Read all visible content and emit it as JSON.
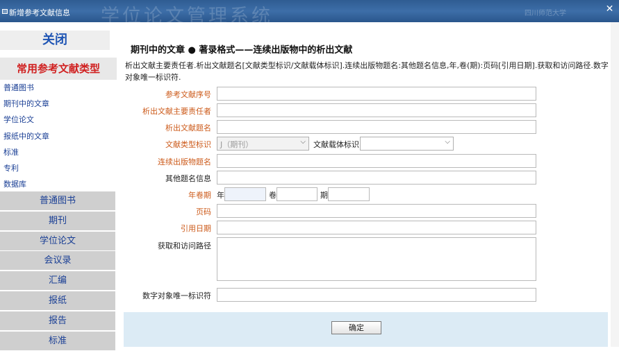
{
  "window": {
    "title": "新增参考文献信息",
    "background_text": "学位论文管理系统",
    "school_text": "四川师范大学",
    "close_icon": "close-icon"
  },
  "sidebar": {
    "close_label": "关闭",
    "category_title": "常用参考文献类型",
    "links": [
      "普通图书",
      "期刊中的文章",
      "学位论文",
      "报纸中的文章",
      "标准",
      "专利",
      "数据库"
    ],
    "buttons": [
      "普通图书",
      "期刊",
      "学位论文",
      "会议录",
      "汇编",
      "报纸",
      "报告",
      "标准"
    ]
  },
  "main": {
    "heading": "期刊中的文章 ● 著录格式——连续出版物中的析出文献",
    "description": "析出文献主要责任者.析出文献题名[文献类型标识/文献载体标识].连续出版物题名:其他题名信息,年,卷(期):页码[引用日期].获取和访问路径.数字对象唯一标识符.",
    "fields": {
      "seq": "参考文献序号",
      "author": "析出文献主要责任者",
      "title": "析出文献题名",
      "doc_type": "文献类型标识",
      "doc_type_value": "J（期刊）",
      "carrier": "文献载体标识",
      "carrier_value": "",
      "serial_title": "连续出版物题名",
      "other_title": "其他题名信息",
      "year_vol": "年卷期",
      "year": "年",
      "volume": "卷",
      "issue": "期",
      "pages": "页码",
      "cite_date": "引用日期",
      "access_path": "获取和访问路径",
      "doi": "数字对象唯一标识符"
    },
    "ok_label": "确定"
  },
  "colors": {
    "titlebar": "#3d6ea8",
    "required_label": "#cc5a1a",
    "link": "#1a3f95",
    "category_title": "#d02020",
    "footer": "#dcebf5"
  }
}
